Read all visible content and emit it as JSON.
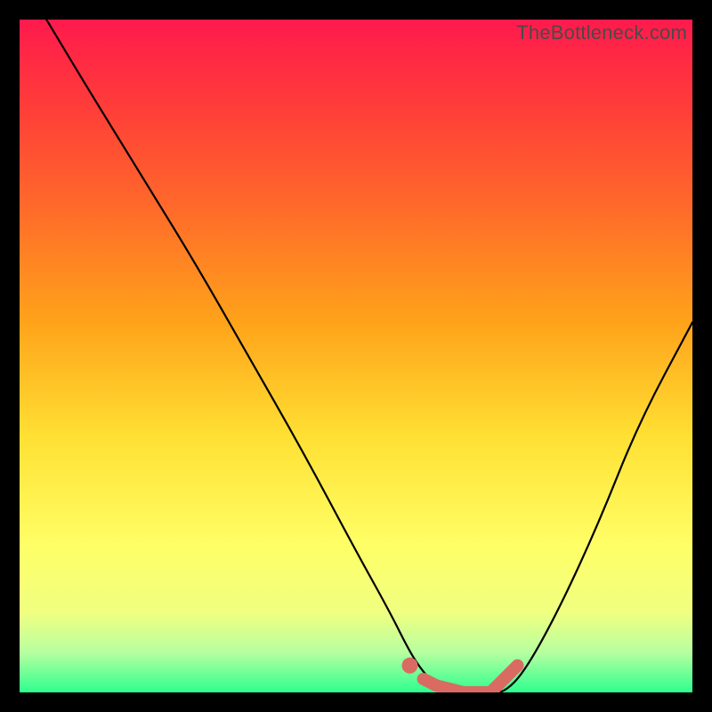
{
  "watermark": "TheBottleneck.com",
  "colors": {
    "curve": "#000000",
    "highlight": "#d96b63",
    "page_bg": "#000000"
  },
  "chart_data": {
    "type": "line",
    "title": "",
    "xlabel": "",
    "ylabel": "",
    "xlim": [
      0,
      100
    ],
    "ylim": [
      0,
      100
    ],
    "grid": false,
    "legend": false,
    "description": "Bottleneck percentage curve on a red-to-green vertical gradient. The curve starts near 100% at x≈4, drops smoothly to ~0% around x≈62, stays near zero until x≈72, then rises back toward ~55% at x≈100. The valley (x≈60–72) is highlighted with a thick salmon stroke and a dot at its start.",
    "series": [
      {
        "name": "bottleneck_curve",
        "x": [
          4,
          10,
          18,
          26,
          34,
          42,
          50,
          55,
          58,
          60,
          62,
          66,
          70,
          72,
          75,
          80,
          86,
          92,
          100
        ],
        "y": [
          100,
          90,
          77,
          64,
          50,
          36,
          21,
          12,
          6,
          3,
          1,
          0,
          0,
          0,
          3,
          12,
          25,
          40,
          55
        ]
      }
    ],
    "highlight": {
      "dot": {
        "x": 58,
        "y": 4
      },
      "segment_x": [
        60,
        62,
        66,
        70,
        72,
        74
      ],
      "segment_y": [
        2,
        1,
        0,
        0,
        2,
        4
      ]
    },
    "gradient_stops": [
      {
        "pct": 0,
        "color": "#ff1a4d"
      },
      {
        "pct": 28,
        "color": "#ff6a2a"
      },
      {
        "pct": 62,
        "color": "#ffe033"
      },
      {
        "pct": 88,
        "color": "#f0ff80"
      },
      {
        "pct": 100,
        "color": "#2eff8f"
      }
    ]
  }
}
